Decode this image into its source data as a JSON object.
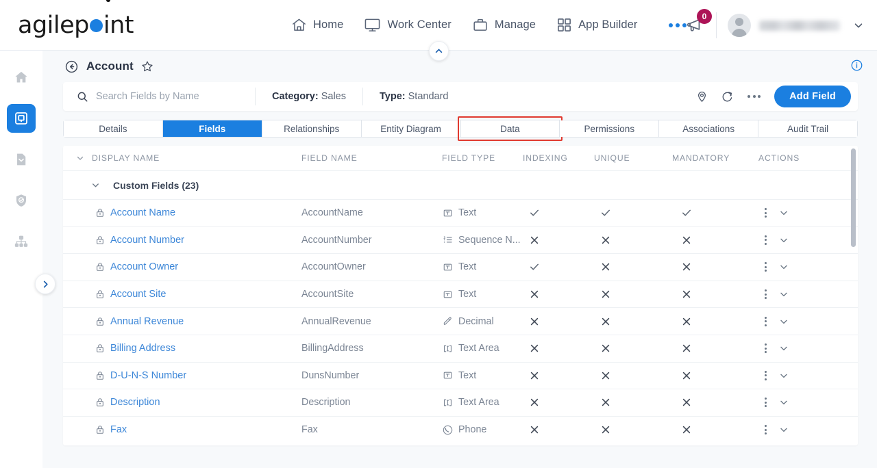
{
  "brand": {
    "name_part1": "agilep",
    "name_part2": "int",
    "accent": "#1b7fe0"
  },
  "topnav": {
    "items": [
      {
        "label": "Home",
        "icon": "home-icon"
      },
      {
        "label": "Work Center",
        "icon": "monitor-icon"
      },
      {
        "label": "Manage",
        "icon": "briefcase-icon"
      },
      {
        "label": "App Builder",
        "icon": "grid-icon"
      }
    ],
    "more_label": "more-options",
    "notification_count": "0",
    "user_name": ""
  },
  "rail": {
    "items": [
      {
        "name": "home-icon",
        "active": false
      },
      {
        "name": "app-explorer-icon",
        "active": true
      },
      {
        "name": "document-icon",
        "active": false
      },
      {
        "name": "shield-check-icon",
        "active": false
      },
      {
        "name": "hierarchy-icon",
        "active": false
      }
    ]
  },
  "page": {
    "title": "Account",
    "back_icon": "back-arrow-icon",
    "favorite_icon": "star-icon",
    "info_icon": "info-icon"
  },
  "toolbar": {
    "search_placeholder": "Search Fields by Name",
    "search_value": "",
    "category_label": "Category:",
    "category_value": "Sales",
    "type_label": "Type:",
    "type_value": "Standard",
    "pin_icon": "location-pin-icon",
    "refresh_icon": "refresh-icon",
    "more_icon": "more-options-icon",
    "add_field_label": "Add Field"
  },
  "tabs": [
    {
      "label": "Details",
      "active": false,
      "highlighted": false
    },
    {
      "label": "Fields",
      "active": true,
      "highlighted": false
    },
    {
      "label": "Relationships",
      "active": false,
      "highlighted": false
    },
    {
      "label": "Entity Diagram",
      "active": false,
      "highlighted": false
    },
    {
      "label": "Data",
      "active": false,
      "highlighted": true
    },
    {
      "label": "Permissions",
      "active": false,
      "highlighted": false
    },
    {
      "label": "Associations",
      "active": false,
      "highlighted": false
    },
    {
      "label": "Audit Trail",
      "active": false,
      "highlighted": false
    }
  ],
  "table": {
    "headers": {
      "display_name": "DISPLAY NAME",
      "field_name": "FIELD NAME",
      "field_type": "FIELD TYPE",
      "indexing": "INDEXING",
      "unique": "UNIQUE",
      "mandatory": "MANDATORY",
      "actions": "ACTIONS"
    },
    "group": {
      "label": "Custom Fields (23)",
      "expanded": true
    },
    "rows": [
      {
        "display_name": "Account Name",
        "field_name": "AccountName",
        "field_type": "Text",
        "type_icon": "text-icon",
        "indexing": "check",
        "unique": "check",
        "mandatory": "check"
      },
      {
        "display_name": "Account Number",
        "field_name": "AccountNumber",
        "field_type": "Sequence N...",
        "type_icon": "sequence-icon",
        "indexing": "cross",
        "unique": "cross",
        "mandatory": "cross"
      },
      {
        "display_name": "Account Owner",
        "field_name": "AccountOwner",
        "field_type": "Text",
        "type_icon": "text-icon",
        "indexing": "check",
        "unique": "cross",
        "mandatory": "cross"
      },
      {
        "display_name": "Account Site",
        "field_name": "AccountSite",
        "field_type": "Text",
        "type_icon": "text-icon",
        "indexing": "cross",
        "unique": "cross",
        "mandatory": "cross"
      },
      {
        "display_name": "Annual Revenue",
        "field_name": "AnnualRevenue",
        "field_type": "Decimal",
        "type_icon": "decimal-icon",
        "indexing": "cross",
        "unique": "cross",
        "mandatory": "cross"
      },
      {
        "display_name": "Billing Address",
        "field_name": "BillingAddress",
        "field_type": "Text Area",
        "type_icon": "text-area-icon",
        "indexing": "cross",
        "unique": "cross",
        "mandatory": "cross"
      },
      {
        "display_name": "D-U-N-S Number",
        "field_name": "DunsNumber",
        "field_type": "Text",
        "type_icon": "text-icon",
        "indexing": "cross",
        "unique": "cross",
        "mandatory": "cross"
      },
      {
        "display_name": "Description",
        "field_name": "Description",
        "field_type": "Text Area",
        "type_icon": "text-area-icon",
        "indexing": "cross",
        "unique": "cross",
        "mandatory": "cross"
      },
      {
        "display_name": "Fax",
        "field_name": "Fax",
        "field_type": "Phone",
        "type_icon": "phone-icon",
        "indexing": "cross",
        "unique": "cross",
        "mandatory": "cross"
      }
    ]
  }
}
